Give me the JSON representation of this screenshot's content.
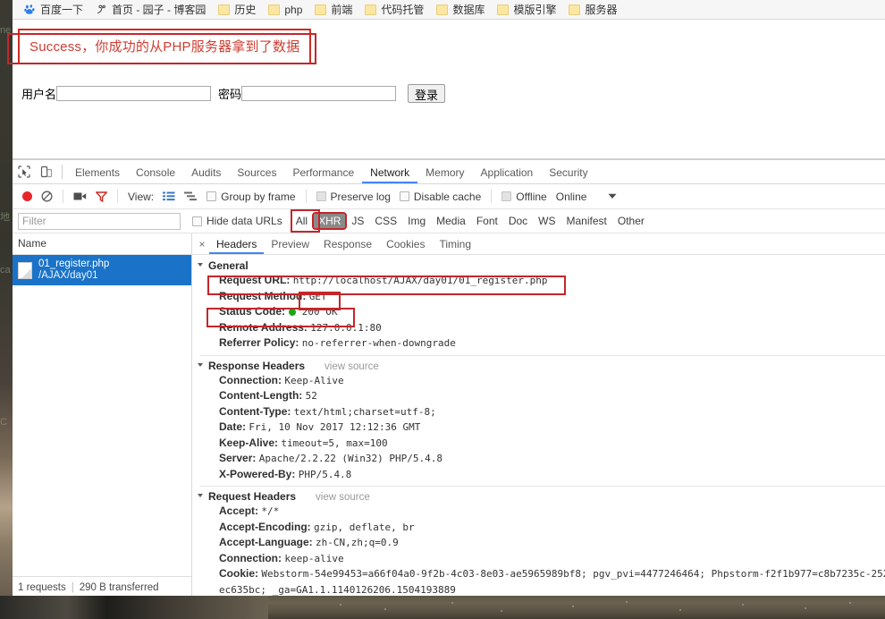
{
  "bookmarks": [
    {
      "label": "百度一下",
      "icon": "baidu-paw-icon",
      "type": "site"
    },
    {
      "label": "首页 - 园子 - 博客园",
      "icon": "cnblogs-icon",
      "type": "site"
    },
    {
      "label": "历史",
      "icon": "folder-icon",
      "type": "folder"
    },
    {
      "label": "php",
      "icon": "folder-icon",
      "type": "folder"
    },
    {
      "label": "前端",
      "icon": "folder-icon",
      "type": "folder"
    },
    {
      "label": "代码托管",
      "icon": "folder-icon",
      "type": "folder"
    },
    {
      "label": "数据库",
      "icon": "folder-icon",
      "type": "folder"
    },
    {
      "label": "模版引擎",
      "icon": "folder-icon",
      "type": "folder"
    },
    {
      "label": "服务器",
      "icon": "folder-icon",
      "type": "folder"
    }
  ],
  "page": {
    "success_message": "Success，你成功的从PHP服务器拿到了数据",
    "success_color": "#d03c32",
    "username_label": "用户名",
    "username_value": "",
    "password_label": "密码",
    "password_value": "",
    "login_button": "登录"
  },
  "devtools": {
    "panel_tabs": [
      "Elements",
      "Console",
      "Audits",
      "Sources",
      "Performance",
      "Network",
      "Memory",
      "Application",
      "Security"
    ],
    "active_panel_tab": "Network",
    "toolbar": {
      "record_tooltip": "record-button",
      "clear_tooltip": "clear-button",
      "camera_tooltip": "capture-screenshots-button",
      "filter_tooltip": "filter-button",
      "view_label": "View:",
      "group_by_frame": "Group by frame",
      "preserve_log": "Preserve log",
      "disable_cache": "Disable cache",
      "offline": "Offline",
      "online": "Online"
    },
    "filterbar": {
      "filter_placeholder": "Filter",
      "filter_value": "",
      "hide_data_urls": "Hide data URLs",
      "types": [
        "All",
        "XHR",
        "JS",
        "CSS",
        "Img",
        "Media",
        "Font",
        "Doc",
        "WS",
        "Manifest",
        "Other"
      ],
      "selected_type": "XHR"
    },
    "request_list": {
      "column_header": "Name",
      "rows": [
        {
          "name": "01_register.php",
          "path": "/AJAX/day01",
          "selected": true
        }
      ],
      "status_requests": "1 requests",
      "status_divider": "|",
      "status_transferred": "290 B transferred"
    },
    "detail": {
      "tabs": [
        "Headers",
        "Preview",
        "Response",
        "Cookies",
        "Timing"
      ],
      "active_tab": "Headers",
      "close_label": "×",
      "sections": [
        {
          "title": "General",
          "view_source": "",
          "rows": [
            {
              "key": "Request URL:",
              "value": "http://localhost/AJAX/day01/01_register.php"
            },
            {
              "key": "Request Method:",
              "value": "GET"
            },
            {
              "key": "Status Code:",
              "value": "200 OK",
              "status_dot": "#1aa51a"
            },
            {
              "key": "Remote Address:",
              "value": "127.0.0.1:80"
            },
            {
              "key": "Referrer Policy:",
              "value": "no-referrer-when-downgrade"
            }
          ]
        },
        {
          "title": "Response Headers",
          "view_source": "view source",
          "rows": [
            {
              "key": "Connection:",
              "value": "Keep-Alive"
            },
            {
              "key": "Content-Length:",
              "value": "52"
            },
            {
              "key": "Content-Type:",
              "value": "text/html;charset=utf-8;"
            },
            {
              "key": "Date:",
              "value": "Fri, 10 Nov 2017 12:12:36 GMT"
            },
            {
              "key": "Keep-Alive:",
              "value": "timeout=5, max=100"
            },
            {
              "key": "Server:",
              "value": "Apache/2.2.22 (Win32) PHP/5.4.8"
            },
            {
              "key": "X-Powered-By:",
              "value": "PHP/5.4.8"
            }
          ]
        },
        {
          "title": "Request Headers",
          "view_source": "view source",
          "rows": [
            {
              "key": "Accept:",
              "value": "*/*"
            },
            {
              "key": "Accept-Encoding:",
              "value": "gzip, deflate, br"
            },
            {
              "key": "Accept-Language:",
              "value": "zh-CN,zh;q=0.9"
            },
            {
              "key": "Connection:",
              "value": "keep-alive"
            },
            {
              "key": "Cookie:",
              "value": "Webstorm-54e99453=a66f04a0-9f2b-4c03-8e03-ae5965989bf8; pgv_pvi=4477246464; Phpstorm-f2f1b977=c8b7235c-252"
            },
            {
              "key": "",
              "value": "ec635bc; _ga=GA1.1.1140126206.1504193889"
            }
          ]
        }
      ]
    }
  },
  "annotations": {
    "color": "#c4262b",
    "boxes": [
      "success-message",
      "request-url",
      "request-method",
      "status-code",
      "xhr-filter"
    ]
  }
}
